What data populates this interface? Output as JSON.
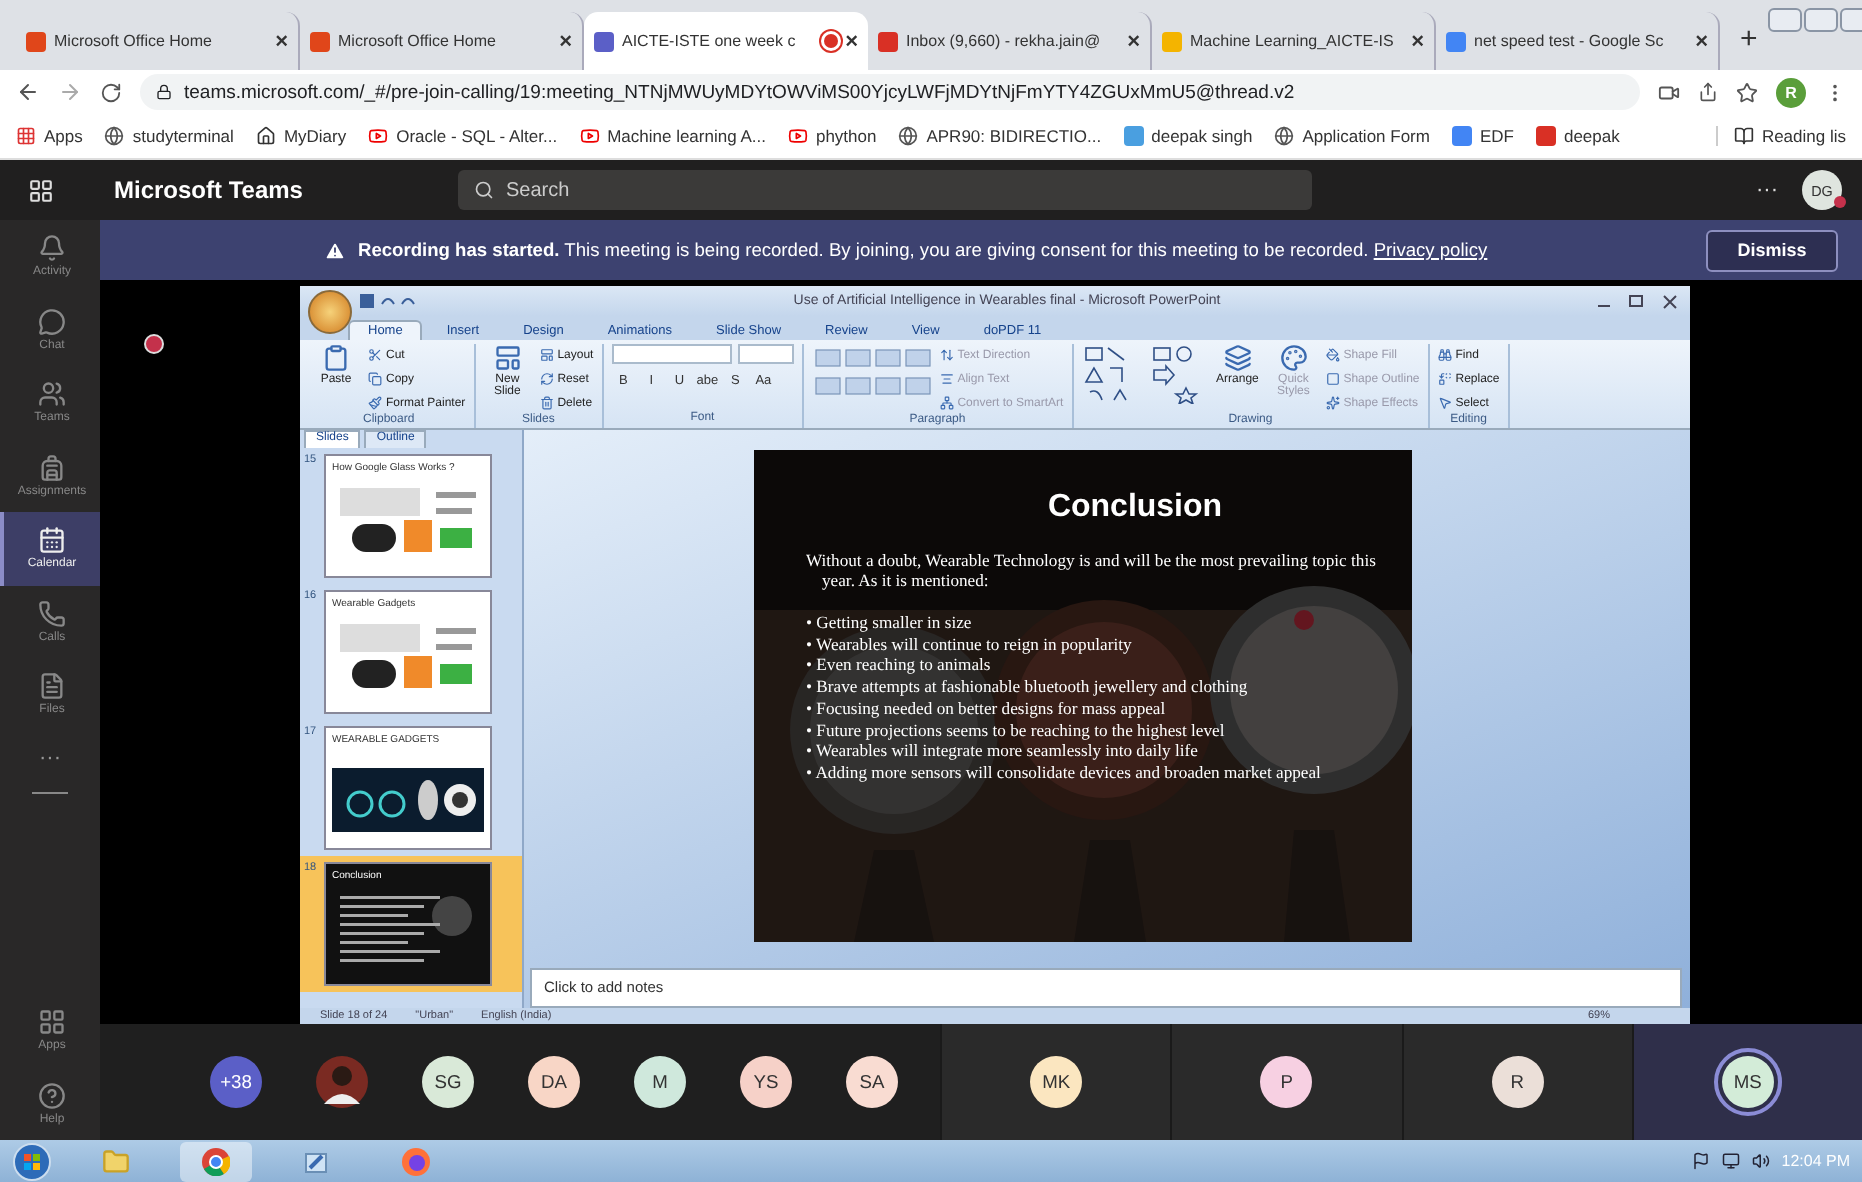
{
  "browser": {
    "tabs": [
      {
        "title": "Microsoft Office Home",
        "selected": false,
        "recording": false
      },
      {
        "title": "Microsoft Office Home",
        "selected": false,
        "recording": false
      },
      {
        "title": "AICTE-ISTE one week c",
        "selected": true,
        "recording": true
      },
      {
        "title": "Inbox (9,660) - rekha.jain@",
        "selected": false,
        "recording": false
      },
      {
        "title": "Machine Learning_AICTE-IS",
        "selected": false,
        "recording": false
      },
      {
        "title": "net speed test - Google Sc",
        "selected": false,
        "recording": false
      }
    ],
    "tab_close": "×",
    "new_tab": "+",
    "url": "teams.microsoft.com/_#/pre-join-calling/19:meeting_NTNjMWUyMDYtOWViMS00YjcyLWFjMDYtNjFmYTY4ZGUxMmU5@thread.v2",
    "profile": "R",
    "bookmarks": [
      "Apps",
      "studyterminal",
      "MyDiary",
      "Oracle - SQL - Alter...",
      "Machine learning A...",
      "phython",
      "APR90: BIDIRECTIO...",
      "deepak singh",
      "Application Form",
      "EDF",
      "deepak"
    ],
    "reading_list": "Reading lis"
  },
  "teams": {
    "app_name": "Microsoft Teams",
    "search": {
      "placeholder": "Search"
    },
    "more": "···",
    "user": "DG",
    "banner": {
      "text": "**Recording has started.** This meeting is being recorded. By joining, you are giving consent for this meeting to be recorded.",
      "link": "Privacy policy",
      "button": "Dismiss"
    },
    "rail": [
      {
        "label": "Activity",
        "selected": false
      },
      {
        "label": "Chat",
        "selected": false
      },
      {
        "label": "Teams",
        "selected": false
      },
      {
        "label": "Assignments",
        "selected": false
      },
      {
        "label": "Calendar",
        "selected": true
      },
      {
        "label": "Calls",
        "selected": false
      },
      {
        "label": "Files",
        "selected": false
      }
    ],
    "rail_more": "···",
    "rail_bottom": [
      "Apps",
      "Help"
    ],
    "strip": [
      {
        "kind": "count",
        "text": "+38",
        "color": "#5b5fc7"
      },
      {
        "kind": "picture",
        "color": "#7a2a22"
      },
      {
        "kind": "initials",
        "text": "SG",
        "color": "#d9e9d8"
      },
      {
        "kind": "initials",
        "text": "DA",
        "color": "#f8d6c6"
      },
      {
        "kind": "initials",
        "text": "M",
        "color": "#cfe8dc"
      },
      {
        "kind": "initials",
        "text": "YS",
        "color": "#f6d1c8"
      },
      {
        "kind": "initials",
        "text": "SA",
        "color": "#f9dcd2"
      }
    ],
    "tiles": [
      {
        "text": "MK",
        "color": "#fbe6c0",
        "speaking": false
      },
      {
        "text": "P",
        "color": "#f7d0e2",
        "speaking": false
      },
      {
        "text": "R",
        "color": "#ebdfd8",
        "speaking": false
      },
      {
        "text": "MS",
        "color": "#d3ecd8",
        "speaking": true
      }
    ]
  },
  "powerpoint": {
    "title": "Use of Artificial Intelligence in Wearables final - Microsoft PowerPoint",
    "tabs": [
      {
        "label": "Home",
        "selected": true
      },
      {
        "label": "Insert",
        "selected": false
      },
      {
        "label": "Design",
        "selected": false
      },
      {
        "label": "Animations",
        "selected": false
      },
      {
        "label": "Slide Show",
        "selected": false
      },
      {
        "label": "Review",
        "selected": false
      },
      {
        "label": "View",
        "selected": false
      },
      {
        "label": "doPDF 11",
        "selected": false
      }
    ],
    "groups": [
      {
        "label": "Clipboard",
        "kind": "clipboard",
        "large": [
          {
            "text": "Paste",
            "disabled": false
          }
        ],
        "small": [
          {
            "text": "Cut",
            "disabled": false
          },
          {
            "text": "Copy",
            "disabled": false
          },
          {
            "text": "Format Painter",
            "disabled": false
          }
        ]
      },
      {
        "label": "Slides",
        "kind": "slides",
        "large": [
          {
            "text": "New Slide",
            "disabled": false
          }
        ],
        "small": [
          {
            "text": "Layout",
            "disabled": false
          },
          {
            "text": "Reset",
            "disabled": false
          },
          {
            "text": "Delete",
            "disabled": false
          }
        ]
      },
      {
        "label": "Font",
        "kind": "font",
        "glyphs": [
          "B",
          "I",
          "U",
          "abe",
          "S",
          "Aa"
        ]
      },
      {
        "label": "Paragraph",
        "kind": "paragraph",
        "small": [
          {
            "text": "Text Direction",
            "disabled": true
          },
          {
            "text": "Align Text",
            "disabled": true
          },
          {
            "text": "Convert to SmartArt",
            "disabled": true
          }
        ]
      },
      {
        "label": "Drawing",
        "kind": "drawing",
        "large": [
          {
            "text": "Arrange",
            "disabled": false
          },
          {
            "text": "Quick Styles",
            "disabled": true
          }
        ],
        "small": [
          {
            "text": "Shape Fill",
            "disabled": true
          },
          {
            "text": "Shape Outline",
            "disabled": true
          },
          {
            "text": "Shape Effects",
            "disabled": true
          }
        ]
      },
      {
        "label": "Editing",
        "kind": "editing",
        "small": [
          {
            "text": "Find",
            "disabled": false
          },
          {
            "text": "Replace",
            "disabled": false
          },
          {
            "text": "Select",
            "disabled": false
          }
        ]
      }
    ],
    "pane_tabs": [
      {
        "label": "Slides",
        "selected": true
      },
      {
        "label": "Outline",
        "selected": false
      }
    ],
    "thumbnails": [
      {
        "number": "15",
        "title": "How Google Glass Works ?",
        "selected": false
      },
      {
        "number": "16",
        "title": "Wearable Gadgets",
        "selected": false
      },
      {
        "number": "17",
        "title": "WEARABLE GADGETS",
        "selected": false
      },
      {
        "number": "18",
        "title": "Conclusion",
        "selected": true
      }
    ],
    "slide": {
      "title": "Conclusion",
      "intro": "Without a doubt, Wearable Technology is and will be the most prevailing topic this year. As it is mentioned:",
      "bullet": "•",
      "bullets": [
        "Getting smaller in size",
        "Wearables will continue to reign in popularity",
        "Even reaching to animals",
        "Brave attempts at fashionable bluetooth jewellery and clothing",
        "Focusing needed on better designs for mass appeal",
        "Future projections seems to be reaching to the highest level",
        "Wearables will integrate more seamlessly into daily life",
        "Adding more sensors will consolidate devices and broaden market appeal"
      ]
    },
    "notes": {
      "placeholder": "Click to add notes"
    },
    "status": [
      "Slide 18 of 24",
      "\"Urban\"",
      "English (India)"
    ],
    "zoom": "69%"
  },
  "taskbar": {
    "apps": [
      {
        "selected": false
      },
      {
        "selected": true
      },
      {
        "selected": false
      },
      {
        "selected": false
      }
    ],
    "time": "12:04 PM"
  }
}
